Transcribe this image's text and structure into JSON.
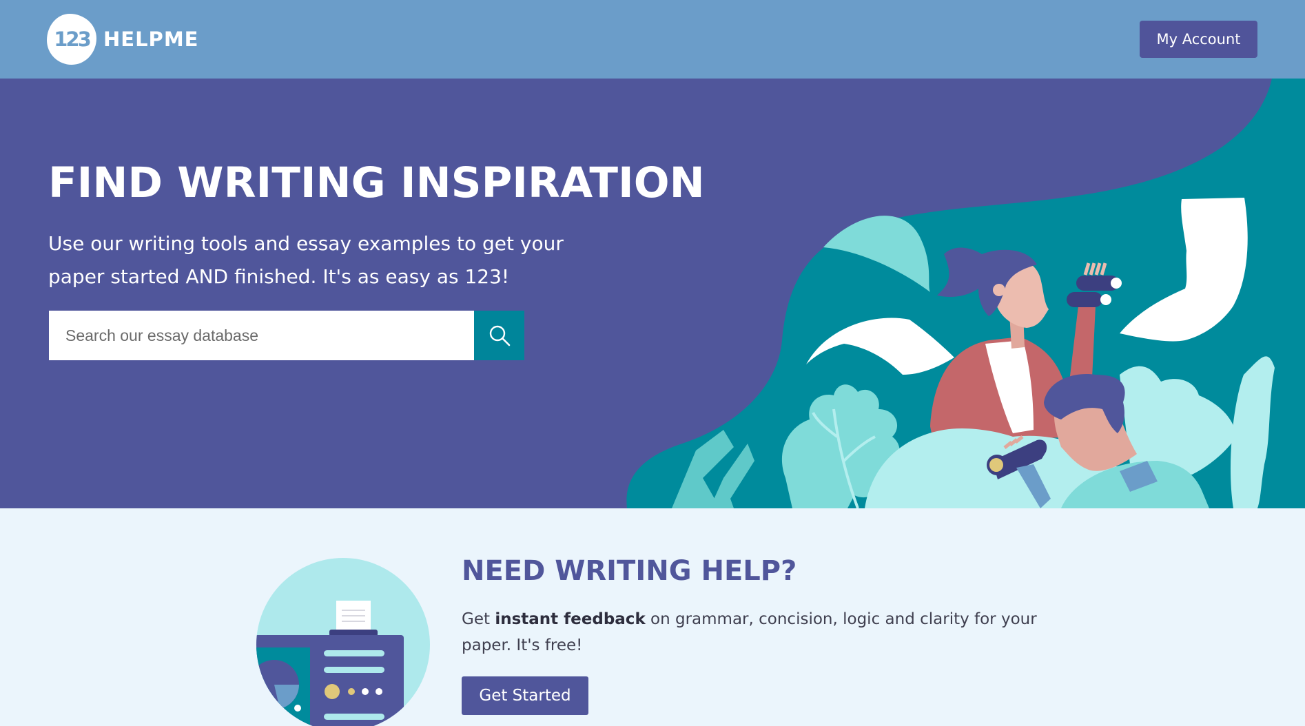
{
  "header": {
    "logo_number": "123",
    "logo_text": "HELPME",
    "account_label": "My Account"
  },
  "hero": {
    "title": "FIND WRITING INSPIRATION",
    "subtitle": "Use our writing tools and essay examples to get your paper started AND finished. It's as easy as 123!",
    "search_placeholder": "Search our essay database",
    "search_icon": "search-icon"
  },
  "help": {
    "title": "NEED WRITING HELP?",
    "text_before": "Get ",
    "text_bold": "instant feedback",
    "text_after": " on grammar, concision, logic and clarity for your paper. It's free!",
    "button_label": "Get Started"
  },
  "colors": {
    "topbar": "#6b9dc9",
    "hero_bg": "#50569b",
    "accent_teal": "#00859a",
    "section_bg": "#ebf5fc",
    "button": "#50569b"
  }
}
